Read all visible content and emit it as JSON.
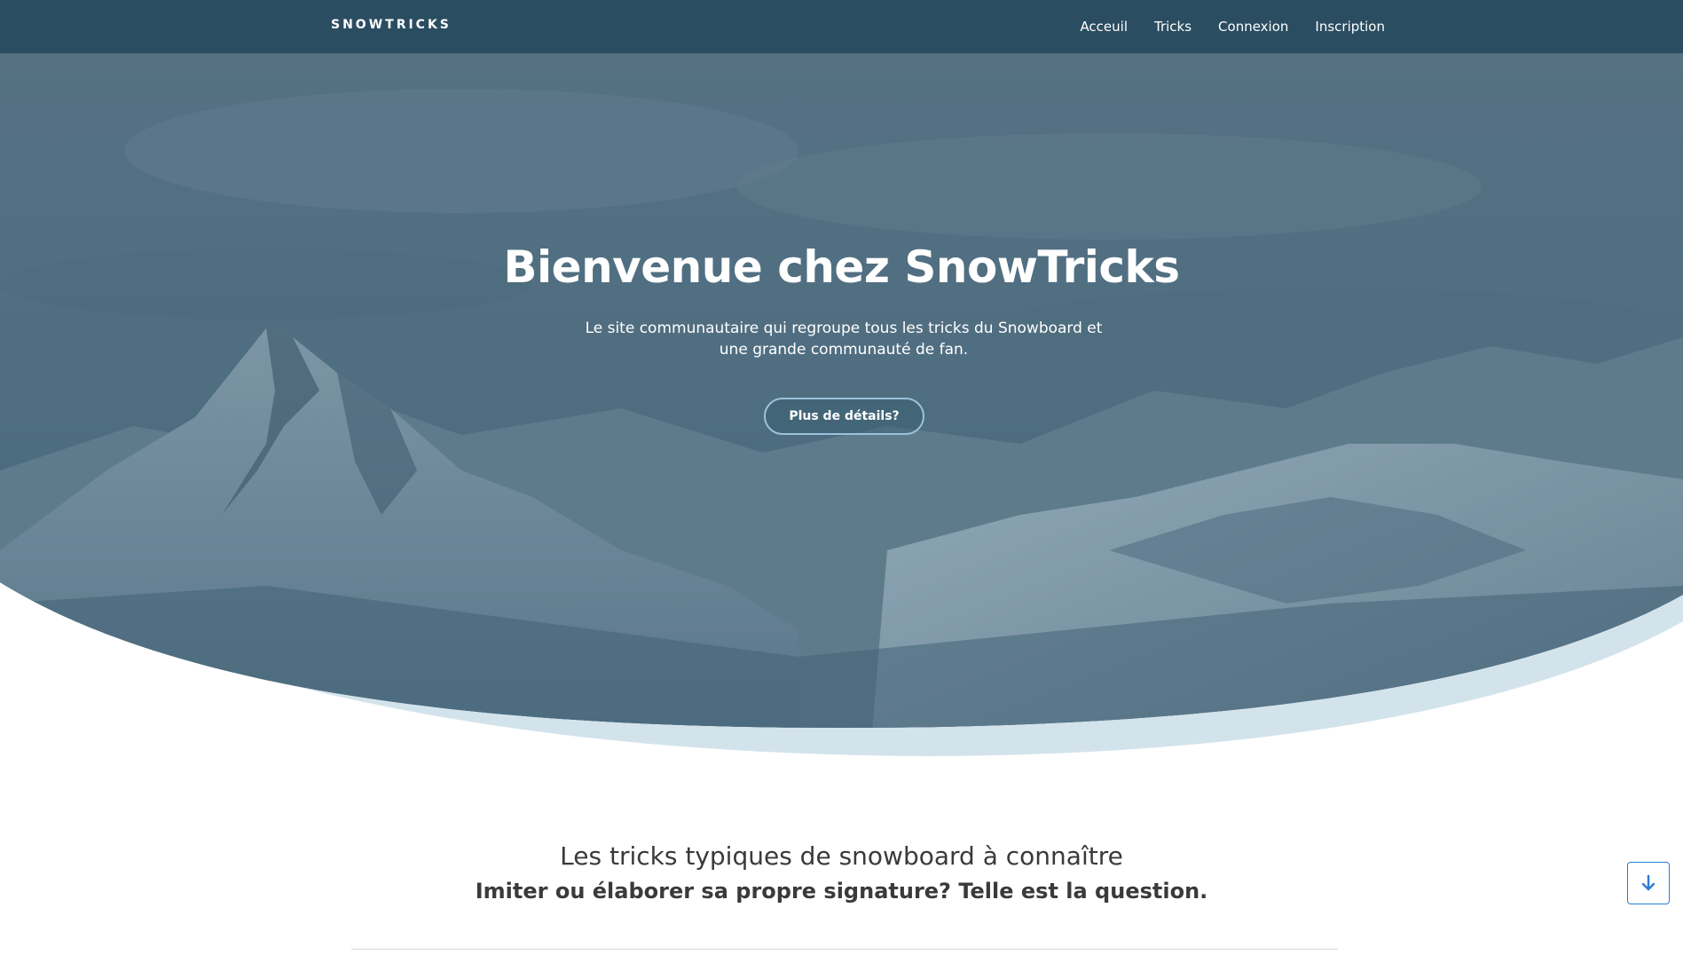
{
  "navbar": {
    "brand": "SNOWTRICKS",
    "links": [
      {
        "label": "Acceuil"
      },
      {
        "label": "Tricks"
      },
      {
        "label": "Connexion"
      },
      {
        "label": "Inscription"
      }
    ]
  },
  "hero": {
    "title": "Bienvenue chez SnowTricks",
    "subtitle": "Le site communautaire qui regroupe tous les tricks du Snowboard et une grande communauté de fan.",
    "button_label": "Plus de détails?"
  },
  "section": {
    "title": "Les tricks typiques de snowboard à connaître",
    "subtitle": "Imiter ou élaborer sa propre signature? Telle est la question."
  },
  "scroll_button": {
    "icon": "arrow-down-icon"
  },
  "colors": {
    "navbar": "#2b4d61",
    "hero_overlay": "#4a6b80",
    "wave_light": "#d3e3ec",
    "accent": "#2a7bd1"
  }
}
